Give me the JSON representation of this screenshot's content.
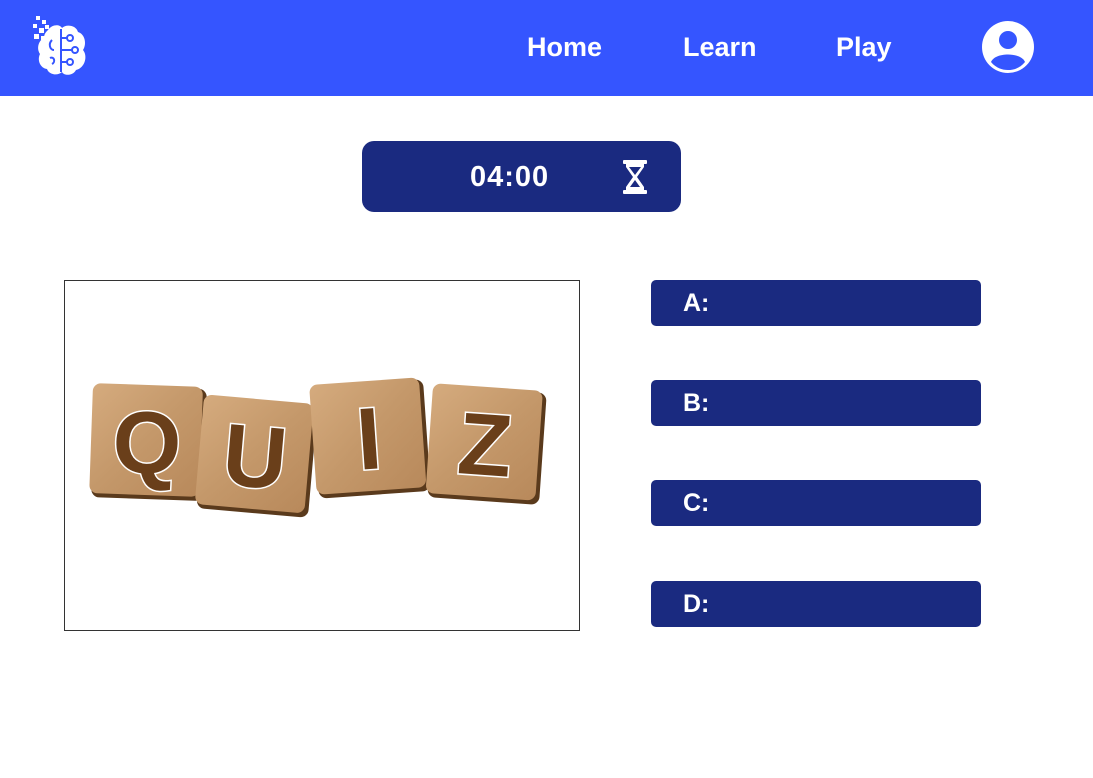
{
  "colors": {
    "navbar": "#3555ff",
    "panel": "#1a2a80",
    "text": "#ffffff",
    "tile": "#c99a6b",
    "tile_letter": "#6a3f1a"
  },
  "header": {
    "logo_icon": "brain-circuit-icon",
    "nav": {
      "home": "Home",
      "learn": "Learn",
      "play": "Play"
    },
    "profile_icon": "user-avatar-icon"
  },
  "timer": {
    "value": "04:00",
    "icon": "hourglass-icon"
  },
  "question_image": {
    "tiles": [
      "Q",
      "U",
      "I",
      "Z"
    ]
  },
  "answers": [
    {
      "label": "A:",
      "text": ""
    },
    {
      "label": "B:",
      "text": ""
    },
    {
      "label": "C:",
      "text": ""
    },
    {
      "label": "D:",
      "text": ""
    }
  ]
}
